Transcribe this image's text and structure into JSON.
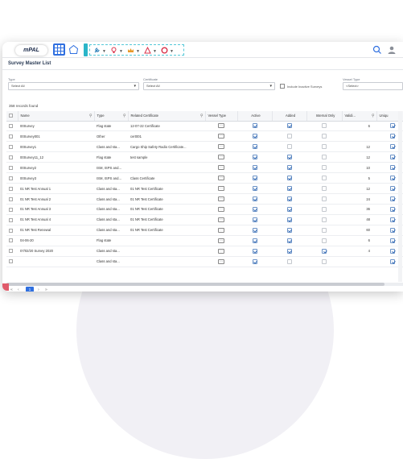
{
  "app": {
    "logo_text": "mPAL",
    "page_title": "Survey Master List"
  },
  "filters": {
    "type_label": "Type",
    "type_value": "Select All",
    "cert_label": "Certificate",
    "cert_value": "Select All",
    "inactive_label": "Include Inactive Surveys",
    "vessel_type_label": "Vessel Type",
    "vessel_type_value": "<Select>"
  },
  "records_text": "358 records found",
  "table": {
    "columns": [
      "Name",
      "Type",
      "Related Certificate",
      "Vessel Type",
      "Active",
      "Added",
      "Internal Only",
      "Validi...",
      "Uniqu"
    ],
    "rows": [
      {
        "name": "00Survey",
        "type": "Flag state",
        "cert": "12-07-22 Certificate",
        "active": true,
        "added": true,
        "internal": false,
        "valid": "6",
        "unique": true
      },
      {
        "name": "00Survey001",
        "type": "Other",
        "cert": "cert001",
        "active": true,
        "added": false,
        "internal": false,
        "valid": "",
        "unique": true
      },
      {
        "name": "00Survey1",
        "type": "Class and sta...",
        "cert": "Cargo Ship Safety Radio Certificate...",
        "active": true,
        "added": false,
        "internal": false,
        "valid": "12",
        "unique": true
      },
      {
        "name": "00Survey11_12",
        "type": "Flag state",
        "cert": "test sample",
        "active": true,
        "added": true,
        "internal": false,
        "valid": "12",
        "unique": true
      },
      {
        "name": "00Survey2",
        "type": "ISM, ISPS and...",
        "cert": "",
        "active": true,
        "added": true,
        "internal": false,
        "valid": "10",
        "unique": true
      },
      {
        "name": "00Survey3",
        "type": "ISM, ISPS and...",
        "cert": "Class Certificate",
        "active": true,
        "added": true,
        "internal": false,
        "valid": "5",
        "unique": true
      },
      {
        "name": "01 NR Test Annual 1",
        "type": "Class and sta...",
        "cert": "01 NR Test Certificate",
        "active": true,
        "added": true,
        "internal": false,
        "valid": "12",
        "unique": true
      },
      {
        "name": "01 NR Test Annual 2",
        "type": "Class and sta...",
        "cert": "01 NR Test Certificate",
        "active": true,
        "added": true,
        "internal": false,
        "valid": "24",
        "unique": true
      },
      {
        "name": "01 NR Test Annual 3",
        "type": "Class and sta...",
        "cert": "01 NR Test Certificate",
        "active": true,
        "added": true,
        "internal": false,
        "valid": "36",
        "unique": true
      },
      {
        "name": "01 NR Test Annual 4",
        "type": "Class and sta...",
        "cert": "01 NR Test Certificate",
        "active": true,
        "added": true,
        "internal": false,
        "valid": "48",
        "unique": true
      },
      {
        "name": "01 NR Test Renewal",
        "type": "Class and sta...",
        "cert": "01 NR Test Certificate",
        "active": true,
        "added": true,
        "internal": false,
        "valid": "60",
        "unique": true
      },
      {
        "name": "04-06-20",
        "type": "Flag state",
        "cert": "",
        "active": true,
        "added": true,
        "internal": false,
        "valid": "6",
        "unique": true
      },
      {
        "name": "07/02/20 Survey 2020",
        "type": "Class and sta...",
        "cert": "",
        "active": true,
        "added": true,
        "internal": true,
        "valid": "4",
        "unique": true
      },
      {
        "name": "",
        "type": "Class and sta...",
        "cert": "",
        "active": true,
        "added": false,
        "internal": false,
        "valid": "",
        "unique": true
      }
    ]
  },
  "pager": {
    "first": "«",
    "prev": "‹",
    "current": "1",
    "next": "›",
    "last": "»"
  },
  "icons": {
    "apps": "grid-icon",
    "home": "home-icon",
    "search": "search-icon",
    "user": "user-icon"
  },
  "colors": {
    "accent": "#2f6fe0",
    "teal": "#2ab5c8",
    "title": "#2a3b55"
  }
}
